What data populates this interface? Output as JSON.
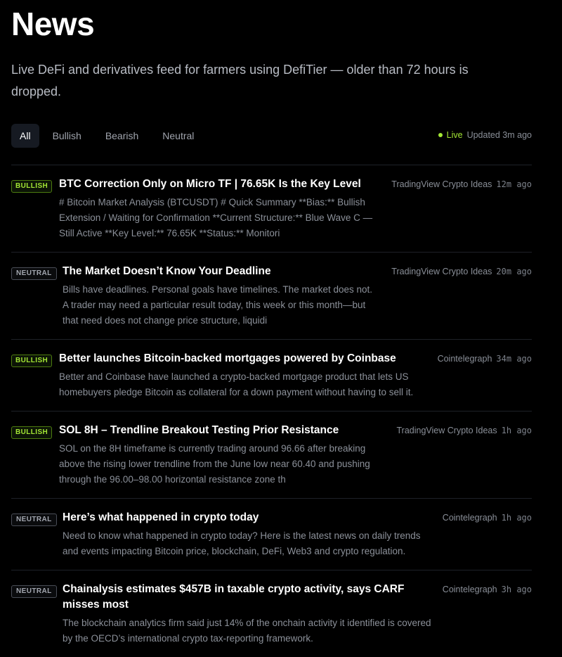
{
  "header": {
    "title": "News",
    "subtitle": "Live DeFi and derivatives feed for farmers using DefiTier — older than 72 hours is dropped."
  },
  "filters": [
    {
      "label": "All",
      "active": true
    },
    {
      "label": "Bullish",
      "active": false
    },
    {
      "label": "Bearish",
      "active": false
    },
    {
      "label": "Neutral",
      "active": false
    }
  ],
  "status": {
    "live_label": "Live",
    "updated": "Updated 3m ago"
  },
  "colors": {
    "accent": "#a3e635",
    "background": "#000000"
  },
  "items": [
    {
      "sentiment": "BULLISH",
      "title": "BTC Correction Only on Micro TF | 76.65K Is the Key Level",
      "description": "# Bitcoin Market Analysis (BTCUSDT) # Quick Summary **Bias:** Bullish Extension / Waiting for Confirmation **Current Structure:** Blue Wave C — Still Active **Key Level:** 76.65K **Status:** Monitori",
      "source": "TradingView Crypto Ideas",
      "time": "12m ago"
    },
    {
      "sentiment": "NEUTRAL",
      "title": "The Market Doesn’t Know Your Deadline",
      "description": "Bills have deadlines. Personal goals have timelines. The market does not. A trader may need a particular result today, this week or this month—but that need does not change price structure, liquidi",
      "source": "TradingView Crypto Ideas",
      "time": "20m ago"
    },
    {
      "sentiment": "BULLISH",
      "title": "Better launches Bitcoin-backed mortgages powered by Coinbase",
      "description": "Better and Coinbase have launched a crypto-backed mortgage product that lets US homebuyers pledge Bitcoin as collateral for a down payment without having to sell it.",
      "source": "Cointelegraph",
      "time": "34m ago"
    },
    {
      "sentiment": "BULLISH",
      "title": "SOL 8H – Trendline Breakout Testing Prior Resistance",
      "description": "SOL on the 8H timeframe is currently trading around 96.66 after breaking above the rising lower trendline from the June low near 60.40 and pushing through the 96.00–98.00 horizontal resistance zone th",
      "source": "TradingView Crypto Ideas",
      "time": "1h ago"
    },
    {
      "sentiment": "NEUTRAL",
      "title": "Here’s what happened in crypto today",
      "description": "Need to know what happened in crypto today? Here is the latest news on daily trends and events impacting Bitcoin price, blockchain, DeFi, Web3 and crypto regulation.",
      "source": "Cointelegraph",
      "time": "1h ago"
    },
    {
      "sentiment": "NEUTRAL",
      "title": "Chainalysis estimates $457B in taxable crypto activity, says CARF misses most",
      "description": "The blockchain analytics firm said just 14% of the onchain activity it identified is covered by the OECD’s international crypto tax-reporting framework.",
      "source": "Cointelegraph",
      "time": "3h ago"
    }
  ]
}
